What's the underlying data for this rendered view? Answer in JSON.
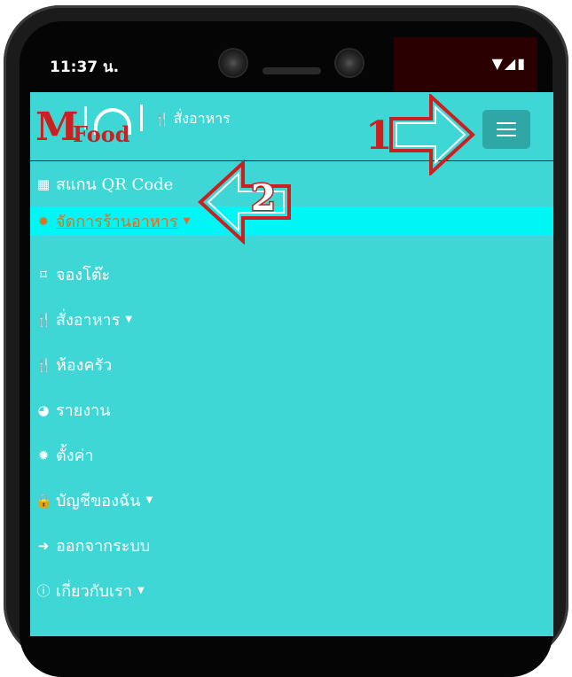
{
  "status": {
    "time": "11:37 น.",
    "icons": "▼◢▮"
  },
  "navbar": {
    "logo_m": "M",
    "logo_food": "Food",
    "brand_icon": "cutlery-icon",
    "brand_label": "สั่งอาหาร",
    "menu_toggle": "hamburger-icon"
  },
  "menu": {
    "items": [
      {
        "icon": "qrcode-icon",
        "label": "สแกน QR Code"
      },
      {
        "icon": "cog-icon",
        "label": "จัดการร้านอาหาร",
        "caret": "▼"
      },
      {
        "icon": "bookmark-icon",
        "label": "จองโต๊ะ"
      },
      {
        "icon": "cutlery-icon",
        "label": "สั่งอาหาร",
        "caret": "▼"
      },
      {
        "icon": "cutlery-icon",
        "label": "ห้องครัว"
      },
      {
        "icon": "pie-chart-icon",
        "label": "รายงาน"
      },
      {
        "icon": "cog-icon",
        "label": "ตั้งค่า"
      },
      {
        "icon": "lock-icon",
        "label": "บัญชีของฉัน",
        "caret": "▼"
      },
      {
        "icon": "sign-out-icon",
        "label": "ออกจากระบบ"
      },
      {
        "icon": "info-circle-icon",
        "label": "เกี่ยวกับเรา",
        "caret": "▼"
      }
    ]
  },
  "annotations": {
    "step1": "1",
    "step2": "2",
    "arrow_color": "#cc1f1f"
  },
  "colors": {
    "screen_bg": "#3fd6d6",
    "active_bg": "#00f5f5",
    "active_text": "#e07020",
    "toggle_bg": "#2fa7a7"
  }
}
